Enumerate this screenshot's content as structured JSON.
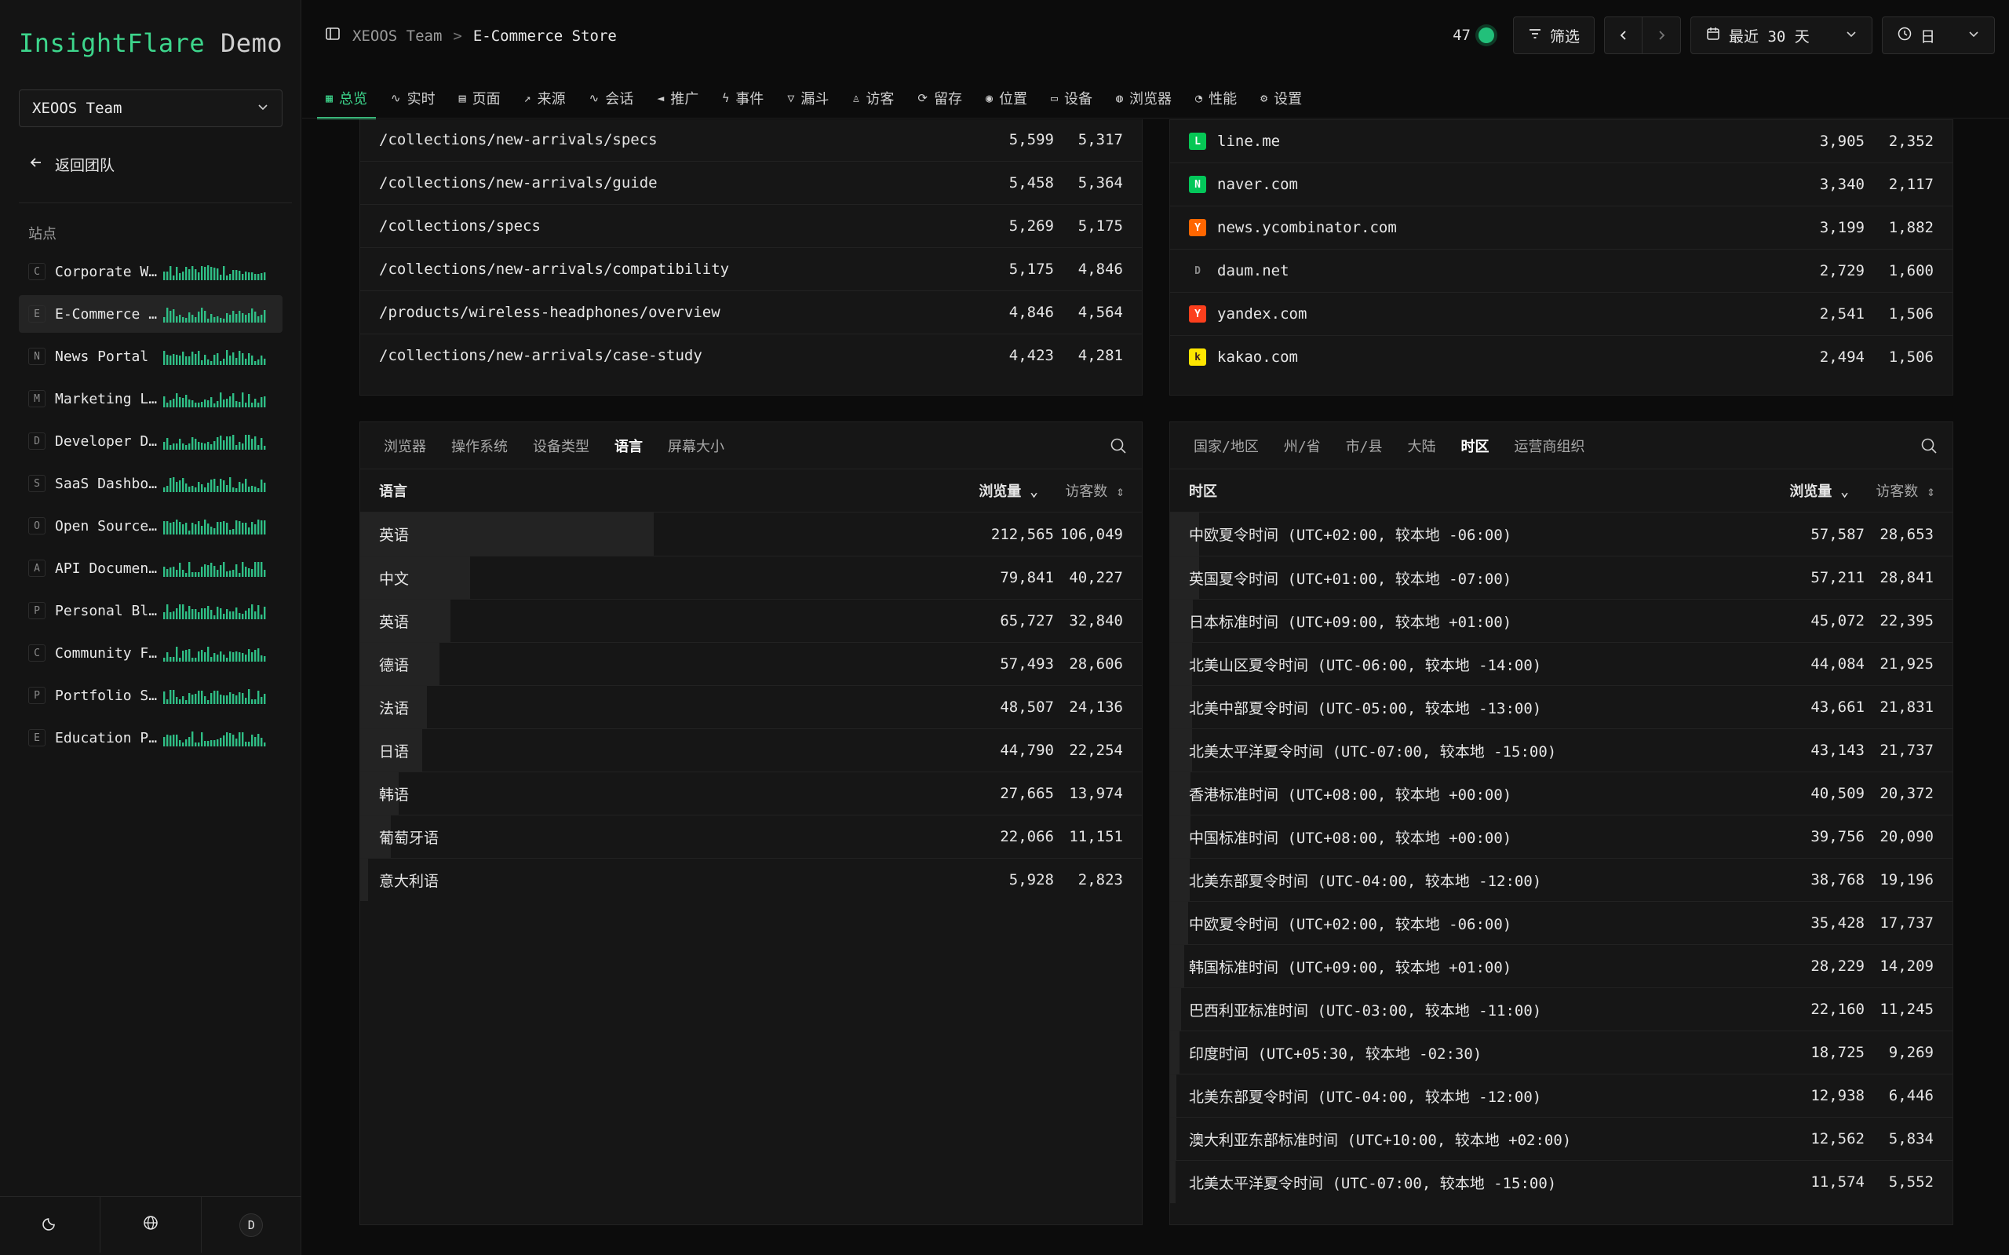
{
  "brand": {
    "name_primary": "InsightFlare",
    "name_secondary": "Demo"
  },
  "sidebar": {
    "team": "XEOOS Team",
    "back": "返回团队",
    "sites_label": "站点",
    "sites": [
      {
        "initial": "C",
        "name": "Corporate W…"
      },
      {
        "initial": "E",
        "name": "E-Commerce …"
      },
      {
        "initial": "N",
        "name": "News Portal"
      },
      {
        "initial": "M",
        "name": "Marketing L…"
      },
      {
        "initial": "D",
        "name": "Developer D…"
      },
      {
        "initial": "S",
        "name": "SaaS Dashbo…"
      },
      {
        "initial": "O",
        "name": "Open Source…"
      },
      {
        "initial": "A",
        "name": "API Documen…"
      },
      {
        "initial": "P",
        "name": "Personal Bl…"
      },
      {
        "initial": "C",
        "name": "Community F…"
      },
      {
        "initial": "P",
        "name": "Portfolio S…"
      },
      {
        "initial": "E",
        "name": "Education P…"
      }
    ],
    "avatar": "D"
  },
  "header": {
    "team": "XEOOS Team",
    "separator": ">",
    "site": "E-Commerce Store",
    "online_count": "47",
    "filter_label": "筛选",
    "range_label": "最近 30 天",
    "granularity_label": "日"
  },
  "tabs": [
    "总览",
    "实时",
    "页面",
    "来源",
    "会话",
    "推广",
    "事件",
    "漏斗",
    "访客",
    "留存",
    "位置",
    "设备",
    "浏览器",
    "性能",
    "设置"
  ],
  "pages_table": {
    "rows": [
      {
        "path": "/collections/new-arrivals/specs",
        "views": "5,599",
        "visitors": "5,317"
      },
      {
        "path": "/collections/new-arrivals/guide",
        "views": "5,458",
        "visitors": "5,364"
      },
      {
        "path": "/collections/specs",
        "views": "5,269",
        "visitors": "5,175"
      },
      {
        "path": "/collections/new-arrivals/compatibility",
        "views": "5,175",
        "visitors": "4,846"
      },
      {
        "path": "/products/wireless-headphones/overview",
        "views": "4,846",
        "visitors": "4,564"
      },
      {
        "path": "/collections/new-arrivals/case-study",
        "views": "4,423",
        "visitors": "4,281"
      }
    ]
  },
  "referrers_table": {
    "rows": [
      {
        "domain": "line.me",
        "icon_color": "#06c755",
        "icon": "L",
        "views": "3,905",
        "visitors": "2,352"
      },
      {
        "domain": "naver.com",
        "icon_color": "#03c75a",
        "icon": "N",
        "views": "3,340",
        "visitors": "2,117"
      },
      {
        "domain": "news.ycombinator.com",
        "icon_color": "#ff6600",
        "icon": "Y",
        "views": "3,199",
        "visitors": "1,882"
      },
      {
        "domain": "daum.net",
        "icon_color": "#161616",
        "icon": "D",
        "views": "2,729",
        "visitors": "1,600"
      },
      {
        "domain": "yandex.com",
        "icon_color": "#fc3f1d",
        "icon": "Y",
        "views": "2,541",
        "visitors": "1,506"
      },
      {
        "domain": "kakao.com",
        "icon_color": "#fee500",
        "icon": "k",
        "views": "2,494",
        "visitors": "1,506"
      }
    ]
  },
  "tech_panel": {
    "tabs": [
      "浏览器",
      "操作系统",
      "设备类型",
      "语言",
      "屏幕大小"
    ],
    "active_tab": 3,
    "col_label": "语言",
    "col_views": "浏览量",
    "col_visitors": "访客数",
    "rows": [
      {
        "label": "英语",
        "views": "212,565",
        "visitors": "106,049",
        "share": 1.0
      },
      {
        "label": "中文",
        "views": "79,841",
        "visitors": "40,227",
        "share": 0.376
      },
      {
        "label": "英语",
        "views": "65,727",
        "visitors": "32,840",
        "share": 0.309
      },
      {
        "label": "德语",
        "views": "57,493",
        "visitors": "28,606",
        "share": 0.27
      },
      {
        "label": "法语",
        "views": "48,507",
        "visitors": "24,136",
        "share": 0.228
      },
      {
        "label": "日语",
        "views": "44,790",
        "visitors": "22,254",
        "share": 0.211
      },
      {
        "label": "韩语",
        "views": "27,665",
        "visitors": "13,974",
        "share": 0.13
      },
      {
        "label": "葡萄牙语",
        "views": "22,066",
        "visitors": "11,151",
        "share": 0.104
      },
      {
        "label": "意大利语",
        "views": "5,928",
        "visitors": "2,823",
        "share": 0.028
      }
    ]
  },
  "geo_panel": {
    "tabs": [
      "国家/地区",
      "州/省",
      "市/县",
      "大陆",
      "时区",
      "运营商组织"
    ],
    "active_tab": 4,
    "col_label": "时区",
    "col_views": "浏览量",
    "col_visitors": "访客数",
    "rows": [
      {
        "label": "中欧夏令时间 (UTC+02:00, 较本地 -06:00)",
        "views": "57,587",
        "visitors": "28,653",
        "share": 0.1
      },
      {
        "label": "英国夏令时间 (UTC+01:00, 较本地 -07:00)",
        "views": "57,211",
        "visitors": "28,841",
        "share": 0.099
      },
      {
        "label": "日本标准时间 (UTC+09:00, 较本地 +01:00)",
        "views": "45,072",
        "visitors": "22,395",
        "share": 0.078
      },
      {
        "label": "北美山区夏令时间 (UTC-06:00, 较本地 -14:00)",
        "views": "44,084",
        "visitors": "21,925",
        "share": 0.076
      },
      {
        "label": "北美中部夏令时间 (UTC-05:00, 较本地 -13:00)",
        "views": "43,661",
        "visitors": "21,831",
        "share": 0.075
      },
      {
        "label": "北美太平洋夏令时间 (UTC-07:00, 较本地 -15:00)",
        "views": "43,143",
        "visitors": "21,737",
        "share": 0.074
      },
      {
        "label": "香港标准时间 (UTC+08:00, 较本地 +00:00)",
        "views": "40,509",
        "visitors": "20,372",
        "share": 0.07
      },
      {
        "label": "中国标准时间 (UTC+08:00, 较本地 +00:00)",
        "views": "39,756",
        "visitors": "20,090",
        "share": 0.069
      },
      {
        "label": "北美东部夏令时间 (UTC-04:00, 较本地 -12:00)",
        "views": "38,768",
        "visitors": "19,196",
        "share": 0.067
      },
      {
        "label": "中欧夏令时间 (UTC+02:00, 较本地 -06:00)",
        "views": "35,428",
        "visitors": "17,737",
        "share": 0.061
      },
      {
        "label": "韩国标准时间 (UTC+09:00, 较本地 +01:00)",
        "views": "28,229",
        "visitors": "14,209",
        "share": 0.049
      },
      {
        "label": "巴西利亚标准时间 (UTC-03:00, 较本地 -11:00)",
        "views": "22,160",
        "visitors": "11,245",
        "share": 0.038
      },
      {
        "label": "印度时间 (UTC+05:30, 较本地 -02:30)",
        "views": "18,725",
        "visitors": "9,269",
        "share": 0.032
      },
      {
        "label": "北美东部夏令时间 (UTC-04:00, 较本地 -12:00)",
        "views": "12,938",
        "visitors": "6,446",
        "share": 0.022
      },
      {
        "label": "澳大利亚东部标准时间 (UTC+10:00, 较本地 +02:00)",
        "views": "12,562",
        "visitors": "5,834",
        "share": 0.022
      },
      {
        "label": "北美太平洋夏令时间 (UTC-07:00, 较本地 -15:00)",
        "views": "11,574",
        "visitors": "5,552",
        "share": 0.02
      }
    ]
  }
}
